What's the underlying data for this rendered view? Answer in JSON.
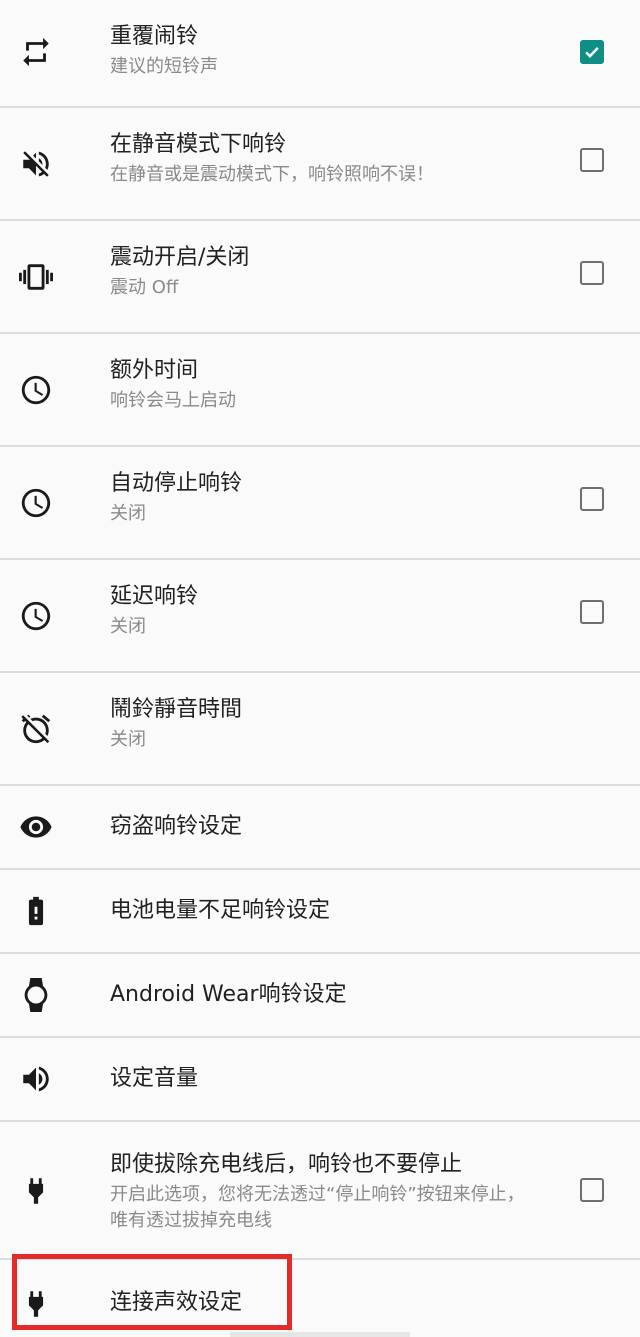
{
  "settings": {
    "repeat_alarm": {
      "title": "重覆闹铃",
      "summary": "建议的短铃声",
      "checked": true
    },
    "ring_in_silent": {
      "title": "在静音模式下响铃",
      "summary": "在静音或是震动模式下，响铃照响不误！",
      "checked": false
    },
    "vibration": {
      "title": "震动开启/关闭",
      "summary": "震动 Off",
      "checked": false
    },
    "extra_time": {
      "title": "额外时间",
      "summary": "响铃会马上启动"
    },
    "auto_stop": {
      "title": "自动停止响铃",
      "summary": "关闭",
      "checked": false
    },
    "delay_ring": {
      "title": "延迟响铃",
      "summary": "关闭",
      "checked": false
    },
    "mute_duration": {
      "title": "鬧鈴靜音時間",
      "summary": "关闭"
    },
    "theft_alarm": {
      "title": "窃盗响铃设定"
    },
    "low_battery": {
      "title": "电池电量不足响铃设定"
    },
    "android_wear": {
      "title": "Android Wear响铃设定"
    },
    "volume": {
      "title": "设定音量"
    },
    "unplug_no_stop": {
      "title": "即使拔除充电线后，响铃也不要停止",
      "summary": "开启此选项，您将无法透过“停止响铃”按钮来停止，唯有透过拔掉充电线",
      "checked": false
    },
    "connect_sound": {
      "title": "连接声效设定"
    }
  },
  "icons": {
    "repeat": "repeat-icon",
    "silent": "volume-off-icon",
    "vibrate": "vibration-icon",
    "clock": "clock-icon",
    "alarm_off": "alarm-off-icon",
    "eye": "eye-icon",
    "battery": "battery-alert-icon",
    "watch": "watch-icon",
    "volume": "volume-up-icon",
    "plug": "power-plug-icon"
  },
  "colors": {
    "accent": "#0f8e85",
    "highlight_border": "#e32b2b",
    "title_text": "#212121",
    "summary_text": "#8a8a8a"
  }
}
